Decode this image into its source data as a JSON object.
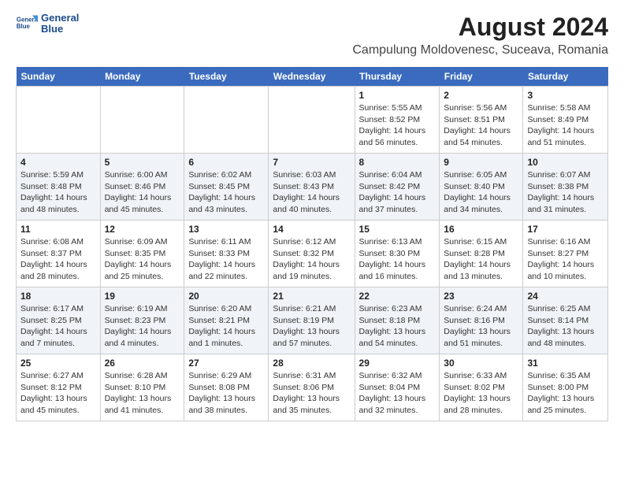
{
  "logo": {
    "line1": "General",
    "line2": "Blue"
  },
  "title": "August 2024",
  "subtitle": "Campulung Moldovenesc, Suceava, Romania",
  "days_of_week": [
    "Sunday",
    "Monday",
    "Tuesday",
    "Wednesday",
    "Thursday",
    "Friday",
    "Saturday"
  ],
  "weeks": [
    [
      {
        "day": "",
        "detail": ""
      },
      {
        "day": "",
        "detail": ""
      },
      {
        "day": "",
        "detail": ""
      },
      {
        "day": "",
        "detail": ""
      },
      {
        "day": "1",
        "detail": "Sunrise: 5:55 AM\nSunset: 8:52 PM\nDaylight: 14 hours\nand 56 minutes."
      },
      {
        "day": "2",
        "detail": "Sunrise: 5:56 AM\nSunset: 8:51 PM\nDaylight: 14 hours\nand 54 minutes."
      },
      {
        "day": "3",
        "detail": "Sunrise: 5:58 AM\nSunset: 8:49 PM\nDaylight: 14 hours\nand 51 minutes."
      }
    ],
    [
      {
        "day": "4",
        "detail": "Sunrise: 5:59 AM\nSunset: 8:48 PM\nDaylight: 14 hours\nand 48 minutes."
      },
      {
        "day": "5",
        "detail": "Sunrise: 6:00 AM\nSunset: 8:46 PM\nDaylight: 14 hours\nand 45 minutes."
      },
      {
        "day": "6",
        "detail": "Sunrise: 6:02 AM\nSunset: 8:45 PM\nDaylight: 14 hours\nand 43 minutes."
      },
      {
        "day": "7",
        "detail": "Sunrise: 6:03 AM\nSunset: 8:43 PM\nDaylight: 14 hours\nand 40 minutes."
      },
      {
        "day": "8",
        "detail": "Sunrise: 6:04 AM\nSunset: 8:42 PM\nDaylight: 14 hours\nand 37 minutes."
      },
      {
        "day": "9",
        "detail": "Sunrise: 6:05 AM\nSunset: 8:40 PM\nDaylight: 14 hours\nand 34 minutes."
      },
      {
        "day": "10",
        "detail": "Sunrise: 6:07 AM\nSunset: 8:38 PM\nDaylight: 14 hours\nand 31 minutes."
      }
    ],
    [
      {
        "day": "11",
        "detail": "Sunrise: 6:08 AM\nSunset: 8:37 PM\nDaylight: 14 hours\nand 28 minutes."
      },
      {
        "day": "12",
        "detail": "Sunrise: 6:09 AM\nSunset: 8:35 PM\nDaylight: 14 hours\nand 25 minutes."
      },
      {
        "day": "13",
        "detail": "Sunrise: 6:11 AM\nSunset: 8:33 PM\nDaylight: 14 hours\nand 22 minutes."
      },
      {
        "day": "14",
        "detail": "Sunrise: 6:12 AM\nSunset: 8:32 PM\nDaylight: 14 hours\nand 19 minutes."
      },
      {
        "day": "15",
        "detail": "Sunrise: 6:13 AM\nSunset: 8:30 PM\nDaylight: 14 hours\nand 16 minutes."
      },
      {
        "day": "16",
        "detail": "Sunrise: 6:15 AM\nSunset: 8:28 PM\nDaylight: 14 hours\nand 13 minutes."
      },
      {
        "day": "17",
        "detail": "Sunrise: 6:16 AM\nSunset: 8:27 PM\nDaylight: 14 hours\nand 10 minutes."
      }
    ],
    [
      {
        "day": "18",
        "detail": "Sunrise: 6:17 AM\nSunset: 8:25 PM\nDaylight: 14 hours\nand 7 minutes."
      },
      {
        "day": "19",
        "detail": "Sunrise: 6:19 AM\nSunset: 8:23 PM\nDaylight: 14 hours\nand 4 minutes."
      },
      {
        "day": "20",
        "detail": "Sunrise: 6:20 AM\nSunset: 8:21 PM\nDaylight: 14 hours\nand 1 minutes."
      },
      {
        "day": "21",
        "detail": "Sunrise: 6:21 AM\nSunset: 8:19 PM\nDaylight: 13 hours\nand 57 minutes."
      },
      {
        "day": "22",
        "detail": "Sunrise: 6:23 AM\nSunset: 8:18 PM\nDaylight: 13 hours\nand 54 minutes."
      },
      {
        "day": "23",
        "detail": "Sunrise: 6:24 AM\nSunset: 8:16 PM\nDaylight: 13 hours\nand 51 minutes."
      },
      {
        "day": "24",
        "detail": "Sunrise: 6:25 AM\nSunset: 8:14 PM\nDaylight: 13 hours\nand 48 minutes."
      }
    ],
    [
      {
        "day": "25",
        "detail": "Sunrise: 6:27 AM\nSunset: 8:12 PM\nDaylight: 13 hours\nand 45 minutes."
      },
      {
        "day": "26",
        "detail": "Sunrise: 6:28 AM\nSunset: 8:10 PM\nDaylight: 13 hours\nand 41 minutes."
      },
      {
        "day": "27",
        "detail": "Sunrise: 6:29 AM\nSunset: 8:08 PM\nDaylight: 13 hours\nand 38 minutes."
      },
      {
        "day": "28",
        "detail": "Sunrise: 6:31 AM\nSunset: 8:06 PM\nDaylight: 13 hours\nand 35 minutes."
      },
      {
        "day": "29",
        "detail": "Sunrise: 6:32 AM\nSunset: 8:04 PM\nDaylight: 13 hours\nand 32 minutes."
      },
      {
        "day": "30",
        "detail": "Sunrise: 6:33 AM\nSunset: 8:02 PM\nDaylight: 13 hours\nand 28 minutes."
      },
      {
        "day": "31",
        "detail": "Sunrise: 6:35 AM\nSunset: 8:00 PM\nDaylight: 13 hours\nand 25 minutes."
      }
    ]
  ]
}
